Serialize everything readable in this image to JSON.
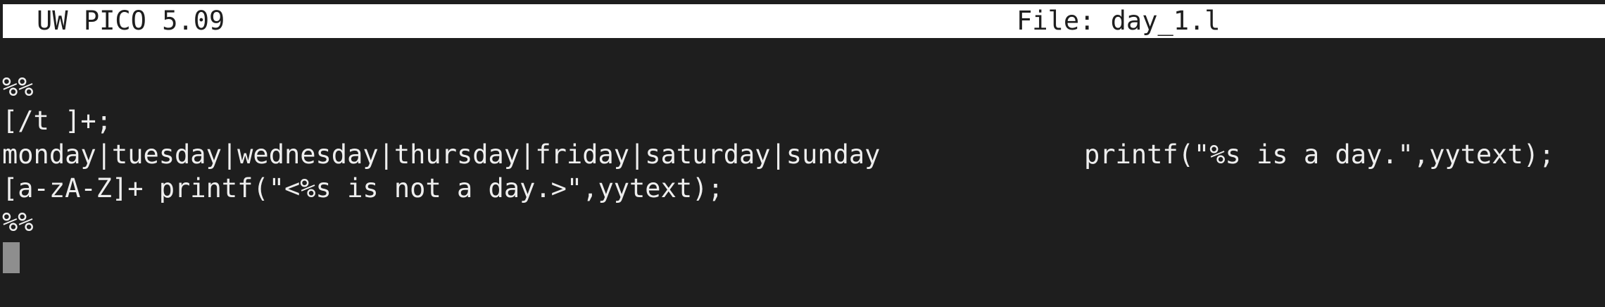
{
  "title_bar": {
    "app": "UW PICO 5.09",
    "file": "File: day_1.l"
  },
  "editor": {
    "lines": [
      "%%",
      "[/t ]+;",
      "monday|tuesday|wednesday|thursday|friday|saturday|sunday",
      "[a-zA-Z]+ printf(\"<%s is not a day.>\",yytext);",
      "%%"
    ],
    "line2_action": "printf(\"%s is a day.\",yytext);"
  }
}
